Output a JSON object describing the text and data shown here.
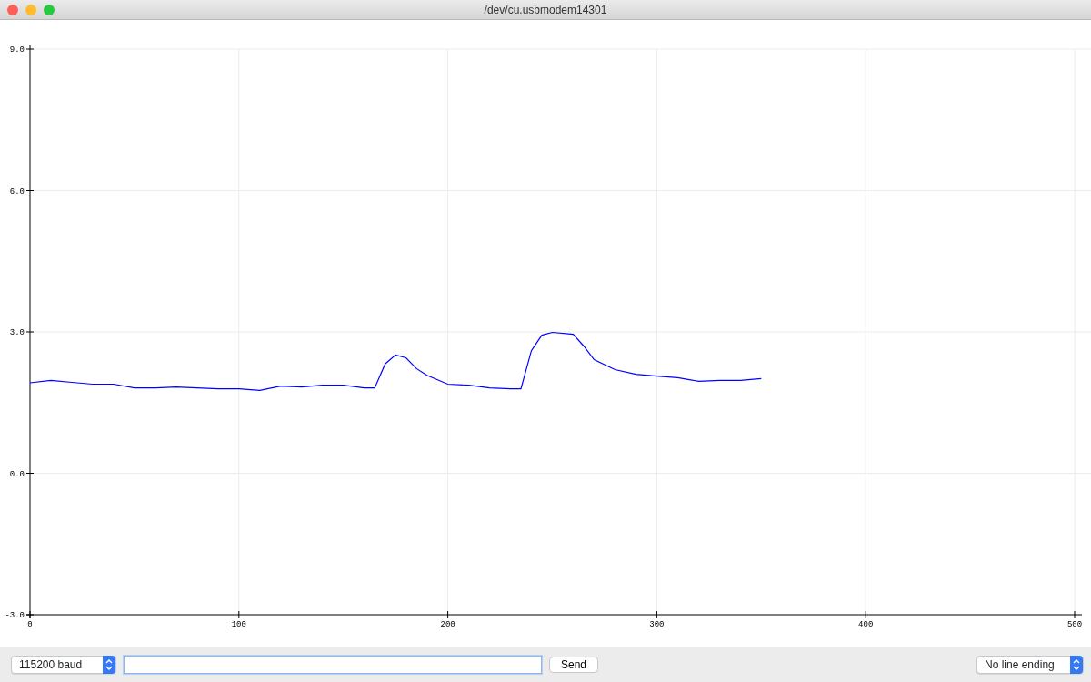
{
  "window": {
    "title": "/dev/cu.usbmodem14301"
  },
  "plot": {
    "chart_data": {
      "type": "line",
      "x": [
        0,
        10,
        20,
        30,
        40,
        50,
        60,
        70,
        80,
        90,
        100,
        110,
        120,
        130,
        140,
        150,
        160,
        165,
        170,
        175,
        180,
        185,
        190,
        200,
        210,
        220,
        230,
        235,
        240,
        245,
        250,
        260,
        265,
        270,
        280,
        290,
        300,
        310,
        320,
        330,
        340,
        350
      ],
      "series": [
        {
          "color": "#0000ff",
          "values": [
            1.92,
            1.97,
            1.93,
            1.89,
            1.89,
            1.81,
            1.81,
            1.83,
            1.81,
            1.79,
            1.79,
            1.76,
            1.85,
            1.83,
            1.87,
            1.87,
            1.81,
            1.81,
            2.32,
            2.51,
            2.45,
            2.22,
            2.08,
            1.89,
            1.87,
            1.81,
            1.79,
            1.79,
            2.6,
            2.93,
            2.99,
            2.95,
            2.7,
            2.41,
            2.2,
            2.1,
            2.06,
            2.03,
            1.95,
            1.97,
            1.97,
            2.01
          ]
        }
      ],
      "grid": true,
      "xlim": [
        0,
        500
      ],
      "ylim": [
        -3,
        9
      ],
      "xticks": [
        0,
        100,
        200,
        300,
        400,
        500
      ],
      "yticks": [
        {
          "value": 9,
          "label": "9.0"
        },
        {
          "value": 6,
          "label": "6.0"
        },
        {
          "value": 3,
          "label": "3.0"
        },
        {
          "value": 0,
          "label": "0.0"
        },
        {
          "value": -3,
          "label": "-3.0"
        }
      ]
    }
  },
  "toolbar": {
    "baud_select": {
      "value": "115200 baud"
    },
    "send_button": {
      "label": "Send"
    },
    "line_ending_select": {
      "value": "No line ending"
    }
  }
}
